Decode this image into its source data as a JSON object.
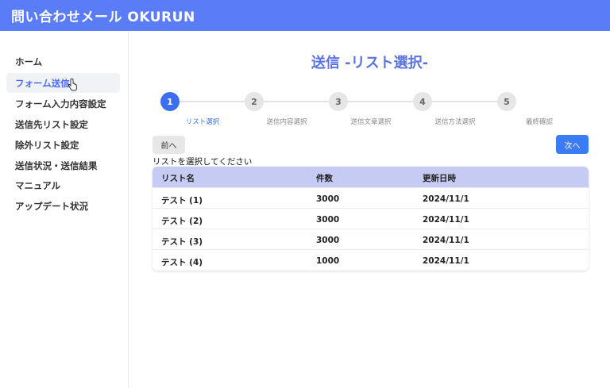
{
  "header": {
    "title": "問い合わせメール OKURUN"
  },
  "sidebar": {
    "items": [
      {
        "label": "ホーム"
      },
      {
        "label": "フォーム送信"
      },
      {
        "label": "フォーム入力内容設定"
      },
      {
        "label": "送信先リスト設定"
      },
      {
        "label": "除外リスト設定"
      },
      {
        "label": "送信状況・送信結果"
      },
      {
        "label": "マニュアル"
      },
      {
        "label": "アップデート状況"
      }
    ],
    "active_index": 1
  },
  "main": {
    "title": "送信 -リスト選択-",
    "steps": [
      {
        "number": "1",
        "label": "リスト選択"
      },
      {
        "number": "2",
        "label": "送信内容選択"
      },
      {
        "number": "3",
        "label": "送信文章選択"
      },
      {
        "number": "4",
        "label": "送信方法選択"
      },
      {
        "number": "5",
        "label": "最終確認"
      }
    ],
    "active_step": 1,
    "prev_label": "前へ",
    "next_label": "次へ",
    "instruction": "リストを選択してください",
    "table": {
      "headers": [
        "リスト名",
        "件数",
        "更新日時"
      ],
      "rows": [
        [
          "テスト (1)",
          "3000",
          "2024/11/1"
        ],
        [
          "テスト (2)",
          "3000",
          "2024/11/1"
        ],
        [
          "テスト (3)",
          "3000",
          "2024/11/1"
        ],
        [
          "テスト (4)",
          "1000",
          "2024/11/1"
        ]
      ]
    }
  },
  "colors": {
    "header_bg": "#5b7cf7",
    "accent": "#3b6ff0",
    "table_head_bg": "#c5cbf2",
    "title_color": "#5b73e0"
  }
}
